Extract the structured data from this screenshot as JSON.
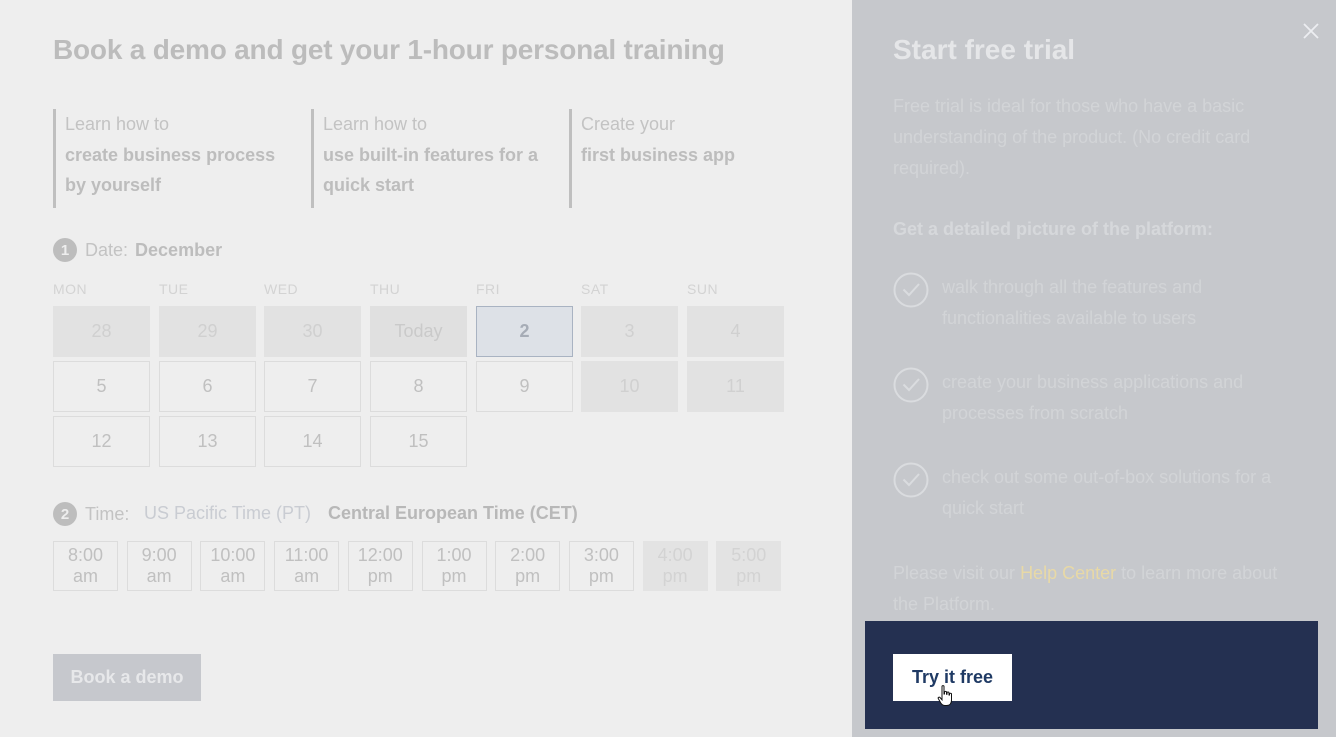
{
  "demo": {
    "title": "Book a demo and get your 1-hour personal training",
    "benefits": [
      {
        "intro": "Learn how to",
        "bold": "create business process by yourself"
      },
      {
        "intro": "Learn how to",
        "bold": "use built-in features for a quick start"
      },
      {
        "intro": "Create your",
        "bold": "first business app"
      }
    ],
    "date_step": {
      "num": "1",
      "label": "Date:",
      "value": "December"
    },
    "weekdays": [
      "MON",
      "TUE",
      "WED",
      "THU",
      "FRI",
      "SAT",
      "SUN"
    ],
    "calendar": [
      {
        "label": "28",
        "state": "off"
      },
      {
        "label": "29",
        "state": "off"
      },
      {
        "label": "30",
        "state": "off"
      },
      {
        "label": "Today",
        "state": "today"
      },
      {
        "label": "2",
        "state": "selected"
      },
      {
        "label": "3",
        "state": "off"
      },
      {
        "label": "4",
        "state": "off"
      },
      {
        "label": "5",
        "state": "on"
      },
      {
        "label": "6",
        "state": "on"
      },
      {
        "label": "7",
        "state": "on"
      },
      {
        "label": "8",
        "state": "on"
      },
      {
        "label": "9",
        "state": "on"
      },
      {
        "label": "10",
        "state": "off"
      },
      {
        "label": "11",
        "state": "off"
      },
      {
        "label": "12",
        "state": "on"
      },
      {
        "label": "13",
        "state": "on"
      },
      {
        "label": "14",
        "state": "on"
      },
      {
        "label": "15",
        "state": "on"
      }
    ],
    "time_step": {
      "num": "2",
      "label": "Time:",
      "tz_pt": "US Pacific Time (PT)",
      "tz_cet": "Central European Time (CET)"
    },
    "slots": [
      {
        "time": "8:00",
        "ampm": "am",
        "state": "on"
      },
      {
        "time": "9:00",
        "ampm": "am",
        "state": "on"
      },
      {
        "time": "10:00",
        "ampm": "am",
        "state": "on"
      },
      {
        "time": "11:00",
        "ampm": "am",
        "state": "on"
      },
      {
        "time": "12:00",
        "ampm": "pm",
        "state": "on"
      },
      {
        "time": "1:00",
        "ampm": "pm",
        "state": "on"
      },
      {
        "time": "2:00",
        "ampm": "pm",
        "state": "on"
      },
      {
        "time": "3:00",
        "ampm": "pm",
        "state": "on"
      },
      {
        "time": "4:00",
        "ampm": "pm",
        "state": "off"
      },
      {
        "time": "5:00",
        "ampm": "pm",
        "state": "off"
      }
    ],
    "book_label": "Book a demo"
  },
  "trial": {
    "title": "Start free trial",
    "description": "Free trial is ideal for those who have a basic understanding of the product. (No credit card required).",
    "subheading": "Get a detailed picture of the platform:",
    "features": [
      "walk through all the features and functionalities available to users",
      "create your business applications and processes from scratch",
      "check out some out-of-box solutions for a quick start"
    ],
    "help_prefix": "Please visit our ",
    "help_link": "Help Center",
    "help_suffix": " to learn more about the Platform.",
    "try_label": "Try it free",
    "icons": {
      "close": "close-icon",
      "check": "check-circle-icon",
      "cursor": "hand-pointer-icon"
    }
  },
  "colors": {
    "cta_panel": "#243051",
    "link": "#e8d9a6",
    "button_text": "#1f3a64"
  }
}
